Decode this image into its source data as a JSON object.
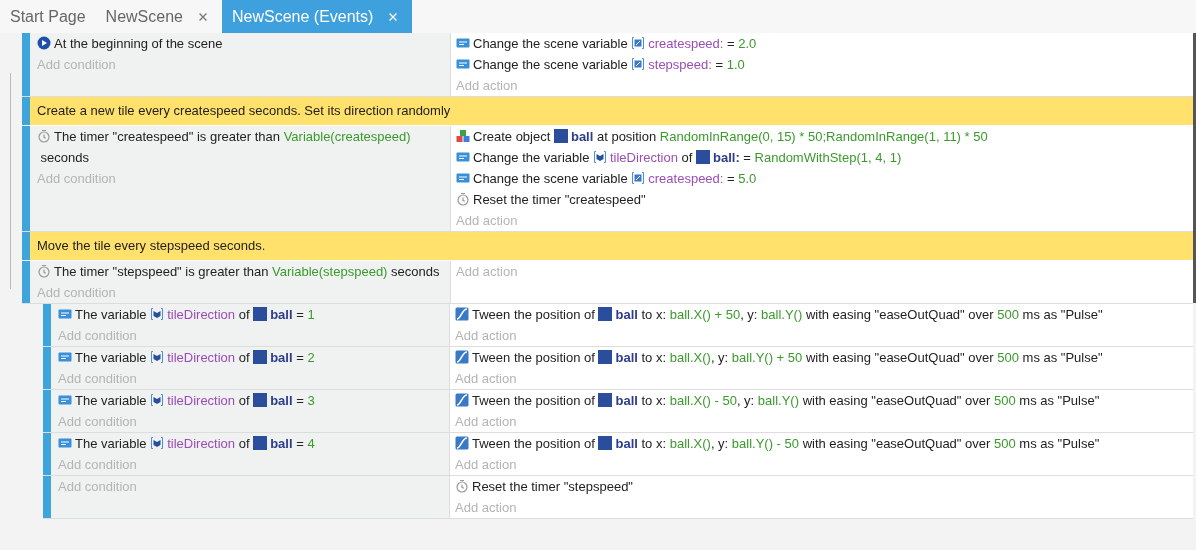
{
  "tabs": [
    {
      "label": "Start Page",
      "closable": false,
      "selected": false
    },
    {
      "label": "NewScene",
      "closable": true,
      "selected": false
    },
    {
      "label": "NewScene (Events)",
      "closable": true,
      "selected": true
    }
  ],
  "events": [
    {
      "kind": "standard",
      "conditions": [
        {
          "kind": "scene_start",
          "parts": [
            {
              "kind": "text",
              "text": "At the beginning of the scene"
            }
          ]
        }
      ],
      "add_condition": "Add condition",
      "actions": [
        {
          "kind": "variable",
          "parts": [
            {
              "kind": "text",
              "text": "Change the scene variable "
            },
            {
              "kind": "scene_variable",
              "text": "createspeed:"
            },
            {
              "kind": "text",
              "text": " = "
            },
            {
              "kind": "expression",
              "text": "2.0"
            }
          ]
        },
        {
          "kind": "variable",
          "parts": [
            {
              "kind": "text",
              "text": "Change the scene variable "
            },
            {
              "kind": "scene_variable",
              "text": "stepspeed:"
            },
            {
              "kind": "text",
              "text": " = "
            },
            {
              "kind": "expression",
              "text": "1.0"
            }
          ]
        }
      ],
      "add_action": "Add action"
    },
    {
      "kind": "comment",
      "text": "Create a new tile every createspeed seconds. Set its direction randomly"
    },
    {
      "kind": "standard",
      "conditions": [
        {
          "kind": "timer",
          "parts": [
            {
              "kind": "text",
              "text": "The timer \"createspeed\" is greater than "
            },
            {
              "kind": "expression",
              "text": "Variable(createspeed)"
            },
            {
              "kind": "text",
              "text": " seconds"
            }
          ]
        }
      ],
      "add_condition": "Add condition",
      "actions": [
        {
          "kind": "create",
          "parts": [
            {
              "kind": "text",
              "text": "Create object "
            },
            {
              "kind": "object",
              "text": "ball"
            },
            {
              "kind": "text",
              "text": " at position "
            },
            {
              "kind": "expression",
              "text": "RandomInRange(0, 15) * 50;RandomInRange(1, 11) * 50"
            }
          ]
        },
        {
          "kind": "variable",
          "parts": [
            {
              "kind": "text",
              "text": "Change the variable "
            },
            {
              "kind": "object_variable",
              "text": "tileDirection"
            },
            {
              "kind": "text",
              "text": " of "
            },
            {
              "kind": "object",
              "text": "ball:"
            },
            {
              "kind": "text",
              "text": " = "
            },
            {
              "kind": "expression",
              "text": "RandomWithStep(1, 4, 1)"
            }
          ]
        },
        {
          "kind": "variable",
          "parts": [
            {
              "kind": "text",
              "text": "Change the scene variable "
            },
            {
              "kind": "scene_variable",
              "text": "createspeed:"
            },
            {
              "kind": "text",
              "text": " = "
            },
            {
              "kind": "expression",
              "text": "5.0"
            }
          ]
        },
        {
          "kind": "timer",
          "parts": [
            {
              "kind": "text",
              "text": "Reset the timer \"createspeed\""
            }
          ]
        }
      ],
      "add_action": "Add action"
    },
    {
      "kind": "comment",
      "text": "Move the tile every stepspeed seconds."
    },
    {
      "kind": "standard",
      "conditions": [
        {
          "kind": "timer",
          "parts": [
            {
              "kind": "text",
              "text": "The timer \"stepspeed\" is greater than "
            },
            {
              "kind": "expression",
              "text": "Variable(stepspeed)"
            },
            {
              "kind": "text",
              "text": " seconds"
            }
          ]
        }
      ],
      "add_condition": "Add condition",
      "add_action": "Add action",
      "children": [
        {
          "kind": "standard",
          "conditions": [
            {
              "kind": "variable",
              "parts": [
                {
                  "kind": "text",
                  "text": "The variable "
                },
                {
                  "kind": "object_variable",
                  "text": "tileDirection"
                },
                {
                  "kind": "text",
                  "text": " of "
                },
                {
                  "kind": "object",
                  "text": "ball"
                },
                {
                  "kind": "text",
                  "text": " = "
                },
                {
                  "kind": "expression",
                  "text": "1"
                }
              ]
            }
          ],
          "add_condition": "Add condition",
          "actions": [
            {
              "kind": "tween",
              "parts": [
                {
                  "kind": "text",
                  "text": "Tween the position of "
                },
                {
                  "kind": "object",
                  "text": "ball"
                },
                {
                  "kind": "text",
                  "text": " to x: "
                },
                {
                  "kind": "expression",
                  "text": "ball.X() + 50"
                },
                {
                  "kind": "text",
                  "text": ", y: "
                },
                {
                  "kind": "expression",
                  "text": "ball.Y()"
                },
                {
                  "kind": "text",
                  "text": " with easing \"easeOutQuad\" over "
                },
                {
                  "kind": "expression",
                  "text": "500"
                },
                {
                  "kind": "text",
                  "text": " ms as \"Pulse\""
                }
              ]
            }
          ],
          "add_action": "Add action"
        },
        {
          "kind": "standard",
          "conditions": [
            {
              "kind": "variable",
              "parts": [
                {
                  "kind": "text",
                  "text": "The variable "
                },
                {
                  "kind": "object_variable",
                  "text": "tileDirection"
                },
                {
                  "kind": "text",
                  "text": " of "
                },
                {
                  "kind": "object",
                  "text": "ball"
                },
                {
                  "kind": "text",
                  "text": " = "
                },
                {
                  "kind": "expression",
                  "text": "2"
                }
              ]
            }
          ],
          "add_condition": "Add condition",
          "actions": [
            {
              "kind": "tween",
              "parts": [
                {
                  "kind": "text",
                  "text": "Tween the position of "
                },
                {
                  "kind": "object",
                  "text": "ball"
                },
                {
                  "kind": "text",
                  "text": " to x: "
                },
                {
                  "kind": "expression",
                  "text": "ball.X()"
                },
                {
                  "kind": "text",
                  "text": ", y: "
                },
                {
                  "kind": "expression",
                  "text": "ball.Y() + 50"
                },
                {
                  "kind": "text",
                  "text": " with easing \"easeOutQuad\" over "
                },
                {
                  "kind": "expression",
                  "text": "500"
                },
                {
                  "kind": "text",
                  "text": " ms as \"Pulse\""
                }
              ]
            }
          ],
          "add_action": "Add action"
        },
        {
          "kind": "standard",
          "conditions": [
            {
              "kind": "variable",
              "parts": [
                {
                  "kind": "text",
                  "text": "The variable "
                },
                {
                  "kind": "object_variable",
                  "text": "tileDirection"
                },
                {
                  "kind": "text",
                  "text": " of "
                },
                {
                  "kind": "object",
                  "text": "ball"
                },
                {
                  "kind": "text",
                  "text": " = "
                },
                {
                  "kind": "expression",
                  "text": "3"
                }
              ]
            }
          ],
          "add_condition": "Add condition",
          "actions": [
            {
              "kind": "tween",
              "parts": [
                {
                  "kind": "text",
                  "text": "Tween the position of "
                },
                {
                  "kind": "object",
                  "text": "ball"
                },
                {
                  "kind": "text",
                  "text": " to x: "
                },
                {
                  "kind": "expression",
                  "text": "ball.X() - 50"
                },
                {
                  "kind": "text",
                  "text": ", y: "
                },
                {
                  "kind": "expression",
                  "text": "ball.Y()"
                },
                {
                  "kind": "text",
                  "text": " with easing \"easeOutQuad\" over "
                },
                {
                  "kind": "expression",
                  "text": "500"
                },
                {
                  "kind": "text",
                  "text": " ms as \"Pulse\""
                }
              ]
            }
          ],
          "add_action": "Add action"
        },
        {
          "kind": "standard",
          "conditions": [
            {
              "kind": "variable",
              "parts": [
                {
                  "kind": "text",
                  "text": "The variable "
                },
                {
                  "kind": "object_variable",
                  "text": "tileDirection"
                },
                {
                  "kind": "text",
                  "text": " of "
                },
                {
                  "kind": "object",
                  "text": "ball"
                },
                {
                  "kind": "text",
                  "text": " = "
                },
                {
                  "kind": "expression",
                  "text": "4"
                }
              ]
            }
          ],
          "add_condition": "Add condition",
          "actions": [
            {
              "kind": "tween",
              "parts": [
                {
                  "kind": "text",
                  "text": "Tween the position of "
                },
                {
                  "kind": "object",
                  "text": "ball"
                },
                {
                  "kind": "text",
                  "text": " to x: "
                },
                {
                  "kind": "expression",
                  "text": "ball.X()"
                },
                {
                  "kind": "text",
                  "text": ", y: "
                },
                {
                  "kind": "expression",
                  "text": "ball.Y() - 50"
                },
                {
                  "kind": "text",
                  "text": " with easing \"easeOutQuad\" over "
                },
                {
                  "kind": "expression",
                  "text": "500"
                },
                {
                  "kind": "text",
                  "text": " ms as \"Pulse\""
                }
              ]
            }
          ],
          "add_action": "Add action"
        },
        {
          "kind": "standard",
          "add_condition": "Add condition",
          "actions": [
            {
              "kind": "timer",
              "parts": [
                {
                  "kind": "text",
                  "text": "Reset the timer \"stepspeed\""
                }
              ]
            }
          ],
          "add_action": "Add action"
        }
      ]
    }
  ]
}
